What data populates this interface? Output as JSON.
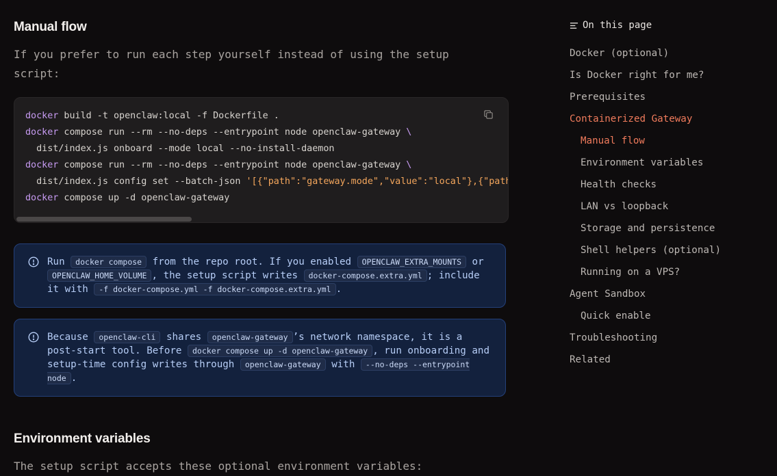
{
  "main": {
    "manual_heading": "Manual flow",
    "manual_intro": "If you prefer to run each step yourself instead of using the setup script:",
    "code_lines": [
      [
        {
          "t": "docker",
          "c": "kw"
        },
        {
          "t": " build -t openclaw:local -f Dockerfile ."
        }
      ],
      [
        {
          "t": "docker",
          "c": "kw"
        },
        {
          "t": " compose run --rm --no-deps --entrypoint node openclaw-gateway "
        },
        {
          "t": "\\",
          "c": "kw"
        }
      ],
      [
        {
          "t": "  dist/index.js onboard --mode local --no-install-daemon"
        }
      ],
      [
        {
          "t": "docker",
          "c": "kw"
        },
        {
          "t": " compose run --rm --no-deps --entrypoint node openclaw-gateway "
        },
        {
          "t": "\\",
          "c": "kw"
        }
      ],
      [
        {
          "t": "  dist/index.js config set --batch-json "
        },
        {
          "t": "'[{\"path\":\"gateway.mode\",\"value\":\"local\"},{\"path\":\"gateway.bind\",\"value\":\"lan\"}]'",
          "c": "str"
        }
      ],
      [
        {
          "t": "docker",
          "c": "kw"
        },
        {
          "t": " compose up -d openclaw-gateway"
        }
      ]
    ],
    "callouts": [
      {
        "parts": [
          {
            "t": "Run "
          },
          {
            "code": "docker compose"
          },
          {
            "t": " from the repo root. If you enabled "
          },
          {
            "code": "OPENCLAW_EXTRA_MOUNTS"
          },
          {
            "t": " or "
          },
          {
            "code": "OPENCLAW_HOME_VOLUME"
          },
          {
            "t": ", the setup script writes "
          },
          {
            "code": "docker-compose.extra.yml"
          },
          {
            "t": "; include it with "
          },
          {
            "code": "-f docker-compose.yml -f docker-compose.extra.yml"
          },
          {
            "t": "."
          }
        ]
      },
      {
        "parts": [
          {
            "t": "Because "
          },
          {
            "code": "openclaw-cli"
          },
          {
            "t": " shares "
          },
          {
            "code": "openclaw-gateway"
          },
          {
            "t": "’s network namespace, it is a post-start tool. Before "
          },
          {
            "code": "docker compose up -d openclaw-gateway"
          },
          {
            "t": ", run onboarding and setup-time config writes through "
          },
          {
            "code": "openclaw-gateway"
          },
          {
            "t": " with "
          },
          {
            "code": "--no-deps --entrypoint node"
          },
          {
            "t": "."
          }
        ]
      }
    ],
    "env_heading": "Environment variables",
    "env_intro": "The setup script accepts these optional environment variables:"
  },
  "toc": {
    "title": "On this page",
    "items": [
      {
        "label": "Docker (optional)",
        "level": 0,
        "active": false
      },
      {
        "label": "Is Docker right for me?",
        "level": 0,
        "active": false
      },
      {
        "label": "Prerequisites",
        "level": 0,
        "active": false
      },
      {
        "label": "Containerized Gateway",
        "level": 0,
        "active": true
      },
      {
        "label": "Manual flow",
        "level": 1,
        "active": true
      },
      {
        "label": "Environment variables",
        "level": 1,
        "active": false
      },
      {
        "label": "Health checks",
        "level": 1,
        "active": false
      },
      {
        "label": "LAN vs loopback",
        "level": 1,
        "active": false
      },
      {
        "label": "Storage and persistence",
        "level": 1,
        "active": false
      },
      {
        "label": "Shell helpers (optional)",
        "level": 1,
        "active": false
      },
      {
        "label": "Running on a VPS?",
        "level": 1,
        "active": false
      },
      {
        "label": "Agent Sandbox",
        "level": 0,
        "active": false
      },
      {
        "label": "Quick enable",
        "level": 1,
        "active": false
      },
      {
        "label": "Troubleshooting",
        "level": 0,
        "active": false
      },
      {
        "label": "Related",
        "level": 0,
        "active": false
      }
    ]
  },
  "icons": {
    "copy": "copy-icon",
    "info": "info-icon",
    "toc": "list-icon"
  },
  "colors": {
    "accent": "#f07b5c",
    "keyword": "#c79bf2",
    "string": "#f4a65c",
    "callout_bg": "#13213d"
  }
}
